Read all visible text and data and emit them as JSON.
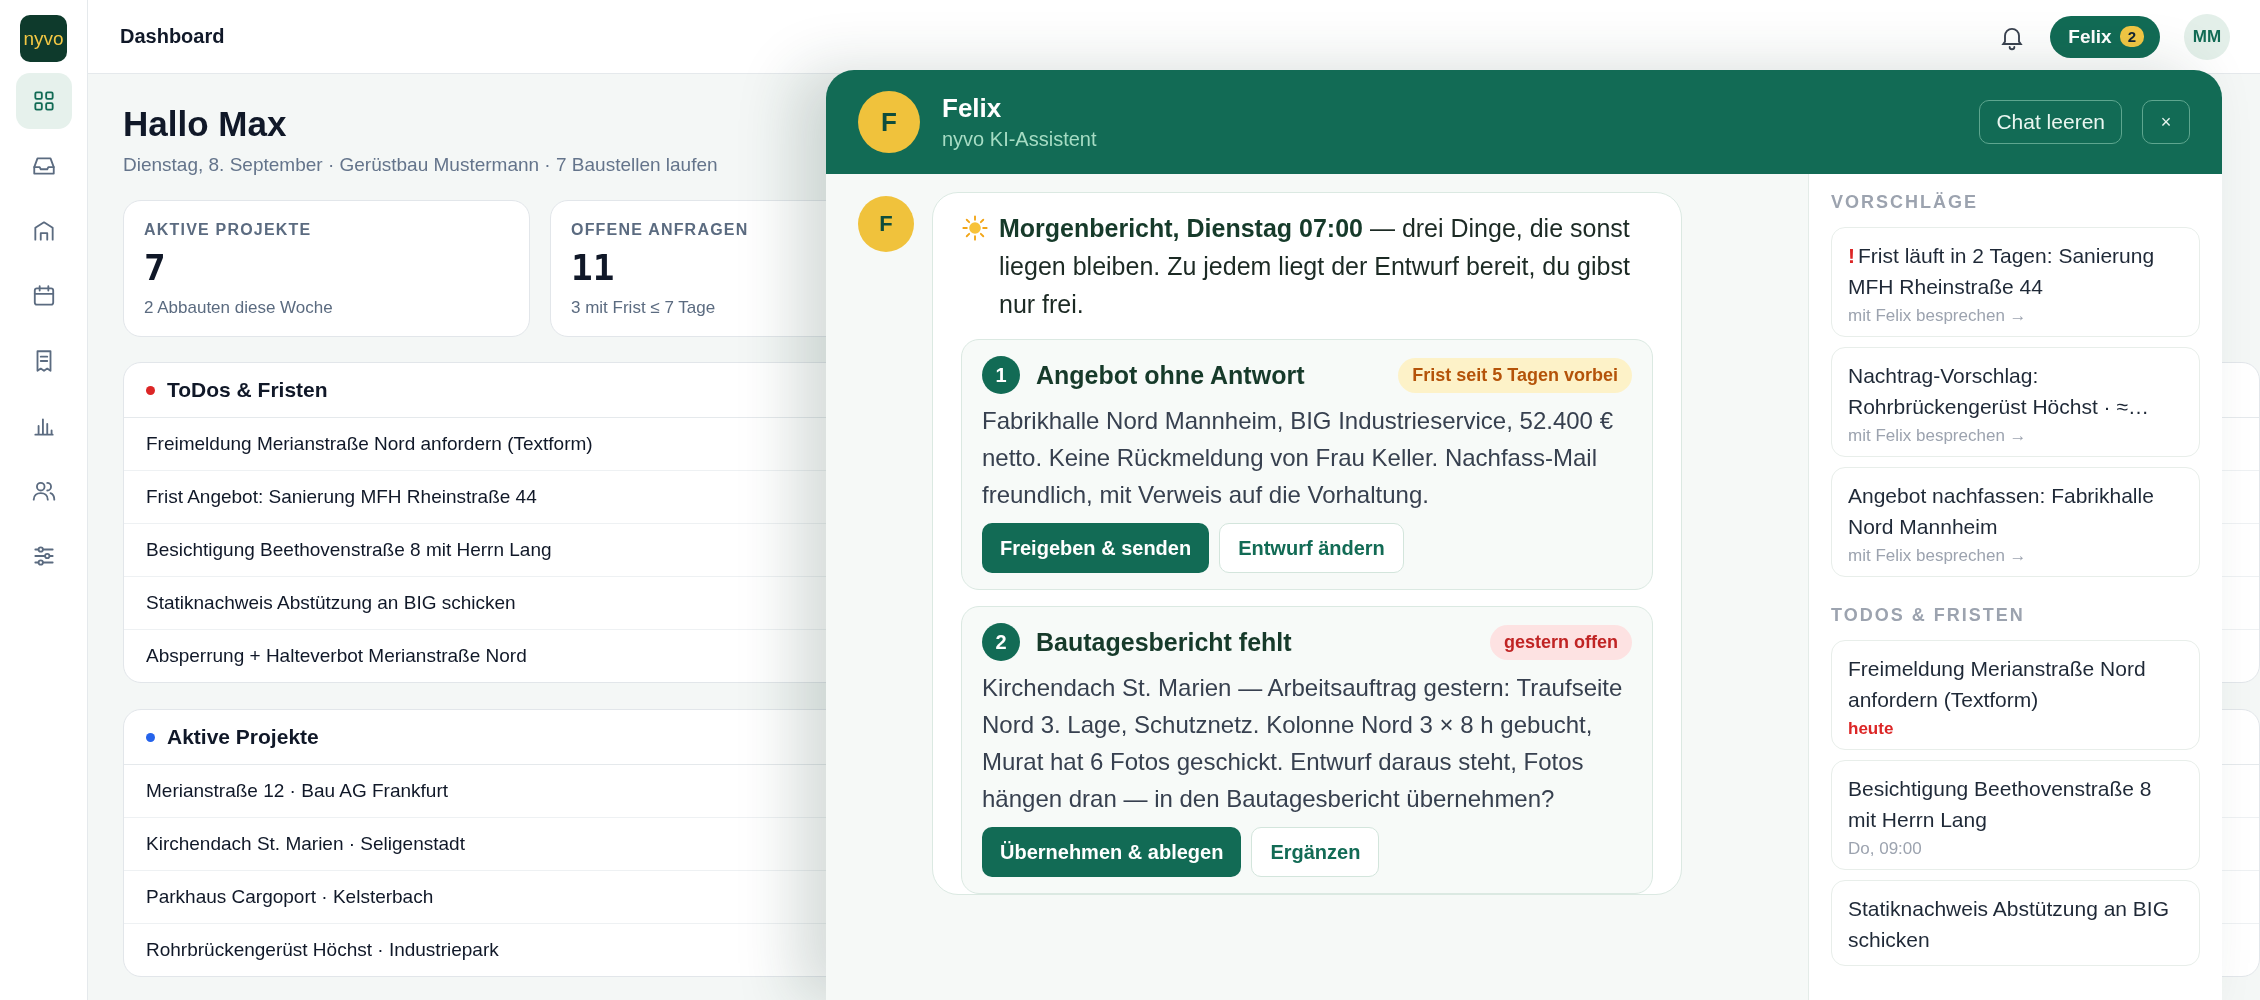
{
  "sidebar": {
    "logo": "nyvo",
    "items": [
      {
        "selected": true
      },
      {
        "selected": false
      },
      {
        "selected": false
      },
      {
        "selected": false
      },
      {
        "selected": false
      },
      {
        "selected": false
      },
      {
        "selected": false
      },
      {
        "selected": false
      }
    ]
  },
  "topbar": {
    "title": "Dashboard",
    "assistant_button": {
      "label": "Felix",
      "count": "2"
    },
    "avatar": "MM"
  },
  "greeting": {
    "title": "Hallo Max",
    "subtitle": "Dienstag, 8. September · Gerüstbau Mustermann · 7 Baustellen laufen"
  },
  "stats": [
    {
      "label": "AKTIVE PROJEKTE",
      "value": "7",
      "note": "2 Abbauten diese Woche"
    },
    {
      "label": "OFFENE ANFRAGEN",
      "value": "11",
      "note": "3 mit Frist ≤ 7 Tage"
    }
  ],
  "lists": [
    {
      "title": "ToDos & Fristen",
      "color": "#dc2626",
      "rows": [
        "Freimeldung Merianstraße Nord anfordern (Textform)",
        "Frist Angebot: Sanierung MFH Rheinstraße 44",
        "Besichtigung Beethovenstraße 8 mit Herrn Lang",
        "Statiknachweis Abstützung an BIG schicken",
        "Absperrung + Halteverbot Merianstraße Nord"
      ]
    },
    {
      "title": "Aktive Projekte",
      "color": "#2563eb",
      "rows": [
        "Merianstraße 12 · Bau AG Frankfurt",
        "Kirchendach St. Marien · Seligenstadt",
        "Parkhaus Cargoport · Kelsterbach",
        "Rohrbrückengerüst Höchst · Industriepark"
      ]
    }
  ],
  "chat": {
    "avatar": "F",
    "name": "Felix",
    "subtitle": "nyvo KI-Assistent",
    "clear_button": "Chat leeren",
    "close_button": "×",
    "message": {
      "avatar": "F",
      "intro": "**Morgenbericht, Dienstag 07:00** — drei Dinge, die sonst liegen bleiben. Zu jedem liegt der Entwurf bereit, du gibst nur frei.",
      "items": [
        {
          "number": "1",
          "title": "Angebot ohne Antwort",
          "badge": {
            "text": "Frist seit 5 Tagen vorbei",
            "kind": "warning"
          },
          "body": "Fabrikhalle Nord Mannheim, BIG Industrieservice, 52.400 € netto. Keine Rückmeldung von Frau Keller. Nachfass-Mail freundlich, mit Verweis auf die Vorhaltung.",
          "buttons": [
            {
              "label": "Freigeben & senden",
              "kind": "primary"
            },
            {
              "label": "Entwurf ändern",
              "kind": "secondary"
            }
          ]
        },
        {
          "number": "2",
          "title": "Bautagesbericht fehlt",
          "badge": {
            "text": "gestern offen",
            "kind": "danger"
          },
          "body": "Kirchendach St. Marien — Arbeitsauftrag gestern: Traufseite Nord 3. Lage, Schutznetz. Kolonne Nord 3 × 8 h gebucht, Murat hat 6 Fotos geschickt. Entwurf daraus steht, Fotos hängen dran — in den Bautagesbericht übernehmen?",
          "buttons": [
            {
              "label": "Übernehmen & ablegen",
              "kind": "primary"
            },
            {
              "label": "Ergänzen",
              "kind": "secondary"
            }
          ]
        }
      ]
    },
    "suggestions": {
      "heading": "VORSCHLÄGE",
      "items": [
        {
          "marker": "!",
          "text": "Frist läuft in 2 Tagen: Sanierung MFH Rheinstraße 44",
          "action": "mit Felix besprechen →"
        },
        {
          "text": "Nachtrag-Vorschlag: Rohrbrückengerüst Höchst · ≈…",
          "action": "mit Felix besprechen →"
        },
        {
          "text": "Angebot nachfassen: Fabrikhalle Nord Mannheim",
          "action": "mit Felix besprechen →"
        }
      ]
    },
    "todos": {
      "heading": "TODOS & FRISTEN",
      "items": [
        {
          "text": "Freimeldung Merianstraße Nord anfordern (Textform)",
          "due": "heute",
          "urgent": true
        },
        {
          "text": "Besichtigung Beethovenstraße 8 mit Herrn Lang",
          "due": "Do, 09:00",
          "urgent": false
        },
        {
          "text": "Statiknachweis Abstützung an BIG schicken"
        }
      ]
    }
  }
}
